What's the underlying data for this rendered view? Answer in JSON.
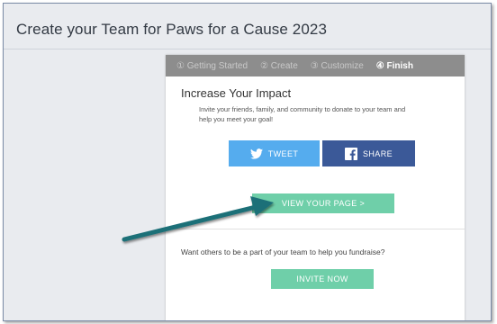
{
  "page": {
    "title": "Create your Team for Paws for a Cause 2023"
  },
  "steps": [
    {
      "label": "① Getting Started",
      "active": false
    },
    {
      "label": "② Create",
      "active": false
    },
    {
      "label": "③ Customize",
      "active": false
    },
    {
      "label": "④ Finish",
      "active": true
    }
  ],
  "impact": {
    "heading": "Increase Your Impact",
    "description": "Invite your friends, family, and community to donate to your team and help you meet your goal!"
  },
  "social": {
    "tweet_label": "TWEET",
    "share_label": "SHARE"
  },
  "view_page_label": "VIEW YOUR PAGE >",
  "fundraise": {
    "prompt": "Want others to be a part of your team to help you fundraise?",
    "invite_label": "INVITE NOW"
  },
  "colors": {
    "twitter": "#55acee",
    "facebook": "#3b5998",
    "action_green": "#6fcfa9",
    "arrow": "#1f6f78"
  },
  "icons": [
    "twitter-bird-icon",
    "facebook-f-icon",
    "pointer-arrow-icon"
  ]
}
